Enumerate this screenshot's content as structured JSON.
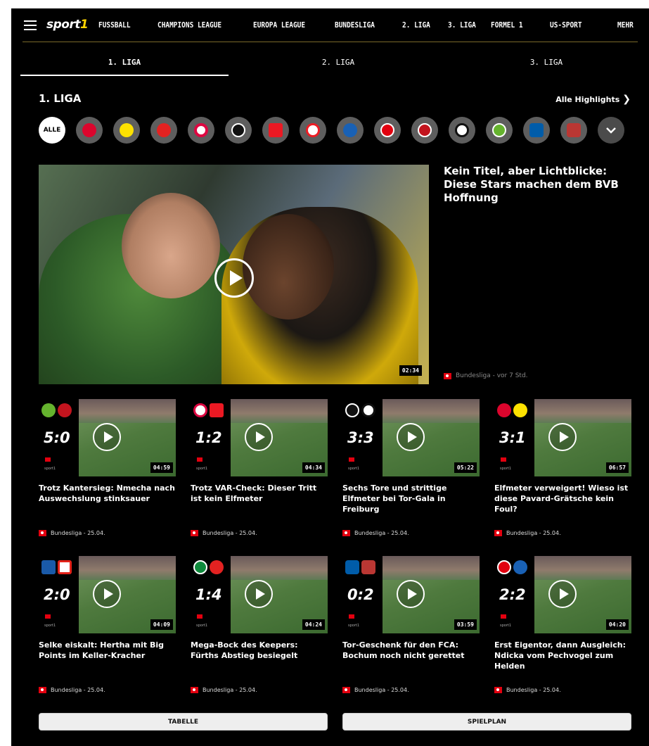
{
  "nav": {
    "logo_text": "sport",
    "logo_accent": "1",
    "items": [
      "FUSSBALL",
      "CHAMPIONS LEAGUE",
      "EUROPA LEAGUE",
      "BUNDESLIGA",
      "2. LIGA",
      "3. LIGA",
      "FORMEL 1",
      "US-SPORT",
      "MEHR"
    ]
  },
  "tabs": [
    {
      "label": "1. LIGA",
      "active": true
    },
    {
      "label": "2. LIGA",
      "active": false
    },
    {
      "label": "3. LIGA",
      "active": false
    }
  ],
  "section": {
    "title": "1. LIGA",
    "all_highlights": "Alle Highlights"
  },
  "team_filter": {
    "all_label": "ALLE",
    "teams": [
      {
        "icon": "fc-bayern-logo-icon",
        "color": "#dc052d"
      },
      {
        "icon": "borussia-dortmund-logo-icon",
        "color": "#fde100"
      },
      {
        "icon": "bayer-leverkusen-logo-icon",
        "color": "#e32221"
      },
      {
        "icon": "rb-leipzig-logo-icon",
        "color": "#dd0741"
      },
      {
        "icon": "sc-freiburg-logo-icon",
        "color": "#111111"
      },
      {
        "icon": "union-berlin-logo-icon",
        "color": "#eb1923"
      },
      {
        "icon": "fc-koeln-logo-icon",
        "color": "#ed1c24"
      },
      {
        "icon": "tsg-hoffenheim-logo-icon",
        "color": "#1961b5"
      },
      {
        "icon": "eintracht-frankfurt-logo-icon",
        "color": "#e1000f"
      },
      {
        "icon": "mainz-05-logo-icon",
        "color": "#c3141e"
      },
      {
        "icon": "gladbach-logo-icon",
        "color": "#111111"
      },
      {
        "icon": "vfl-wolfsburg-logo-icon",
        "color": "#65b32e"
      },
      {
        "icon": "vfl-bochum-logo-icon",
        "color": "#005ca9"
      },
      {
        "icon": "fc-augsburg-logo-icon",
        "color": "#ba3733"
      }
    ],
    "more_icon": "chevron-down-icon"
  },
  "hero": {
    "title": "Kein Titel, aber Lichtblicke: Diese Stars machen dem BVB Hoffnung",
    "duration": "02:34",
    "meta": "Bundesliga - vor 7 Std."
  },
  "cards": [
    {
      "score": "5:0",
      "teams": [
        "wolfsburg-logo-icon",
        "mainz-logo-icon"
      ],
      "duration": "04:59",
      "title": "Trotz Kantersieg: Nmecha nach Auswechslung stinksauer",
      "meta": "Bundesliga - 25.04."
    },
    {
      "score": "1:2",
      "teams": [
        "leipzig-logo-icon",
        "union-logo-icon"
      ],
      "duration": "04:34",
      "title": "Trotz VAR-Check: Dieser Tritt ist kein Elfmeter",
      "meta": "Bundesliga - 25.04."
    },
    {
      "score": "3:3",
      "teams": [
        "freiburg-logo-icon",
        "gladbach-logo-icon"
      ],
      "duration": "05:22",
      "title": "Sechs Tore und strittige Elfmeter bei Tor-Gala in Freiburg",
      "meta": "Bundesliga - 25.04."
    },
    {
      "score": "3:1",
      "teams": [
        "bayern-logo-icon",
        "dortmund-logo-icon"
      ],
      "duration": "06:57",
      "title": "Elfmeter verweigert! Wieso ist diese Pavard-Grätsche kein Foul?",
      "meta": "Bundesliga - 25.04."
    },
    {
      "score": "2:0",
      "teams": [
        "hertha-logo-icon",
        "stuttgart-logo-icon"
      ],
      "duration": "04:09",
      "title": "Selke eiskalt: Hertha mit Big Points im Keller-Kracher",
      "meta": "Bundesliga - 25.04."
    },
    {
      "score": "1:4",
      "teams": [
        "fuerth-logo-icon",
        "leverkusen-logo-icon"
      ],
      "duration": "04:24",
      "title": "Mega-Bock des Keepers: Fürths Abstieg besiegelt",
      "meta": "Bundesliga - 25.04."
    },
    {
      "score": "0:2",
      "teams": [
        "bochum-logo-icon",
        "augsburg-logo-icon"
      ],
      "duration": "03:59",
      "title": "Tor-Geschenk für den FCA: Bochum noch nicht gerettet",
      "meta": "Bundesliga - 25.04."
    },
    {
      "score": "2:2",
      "teams": [
        "frankfurt-logo-icon",
        "hoffenheim-logo-icon"
      ],
      "duration": "04:20",
      "title": "Erst Eigentor, dann Ausgleich: Ndicka vom Pechvogel zum Helden",
      "meta": "Bundesliga - 25.04."
    }
  ],
  "buttons": {
    "table": "TABELLE",
    "schedule": "SPIELPLAN"
  },
  "colors": {
    "background": "#000000",
    "brand_accent": "#ffd400",
    "bundesliga_red": "#e3000f"
  }
}
